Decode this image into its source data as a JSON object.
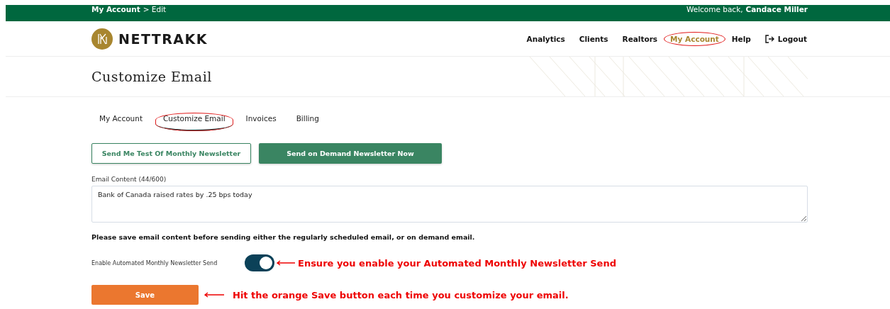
{
  "breadcrumb": {
    "current": "My Account",
    "rest": "> Edit"
  },
  "welcome": {
    "text": "Welcome back,",
    "name": "Candace Miller"
  },
  "logo": {
    "text": "NETTRAKK"
  },
  "nav": [
    {
      "label": "Analytics",
      "selected": false,
      "circled": false,
      "kind": "link"
    },
    {
      "label": "Clients",
      "selected": false,
      "circled": false,
      "kind": "link"
    },
    {
      "label": "Realtors",
      "selected": false,
      "circled": false,
      "kind": "link"
    },
    {
      "label": "My Account",
      "selected": true,
      "circled": true,
      "kind": "link"
    },
    {
      "label": "Help",
      "selected": false,
      "circled": false,
      "kind": "link"
    },
    {
      "label": "Logout",
      "selected": false,
      "circled": false,
      "kind": "logout"
    }
  ],
  "page_title": "Customize Email",
  "tabs": [
    {
      "label": "My Account",
      "selected": false,
      "circled": false
    },
    {
      "label": "Customize Email",
      "selected": true,
      "circled": true
    },
    {
      "label": "Invoices",
      "selected": false,
      "circled": false
    },
    {
      "label": "Billing",
      "selected": false,
      "circled": false
    }
  ],
  "buttons": [
    {
      "label": "Send Me Test Of Monthly Newsletter",
      "kind": "outline"
    },
    {
      "label": "Send on Demand Newsletter Now",
      "kind": "filled"
    }
  ],
  "email_content": {
    "label": "Email Content (44/600)",
    "value": "Bank of Canada raised rates by .25 bps today"
  },
  "notice": "Please save email content before sending either the regularly scheduled email, or on demand email.",
  "toggle": {
    "label": "Enable Automated Monthly Newsletter Send",
    "on": true,
    "annotation": "Ensure you enable your Automated Monthly Newsletter Send"
  },
  "save": {
    "label": "Save",
    "annotation": "Hit the orange Save button each time you customize your email."
  }
}
